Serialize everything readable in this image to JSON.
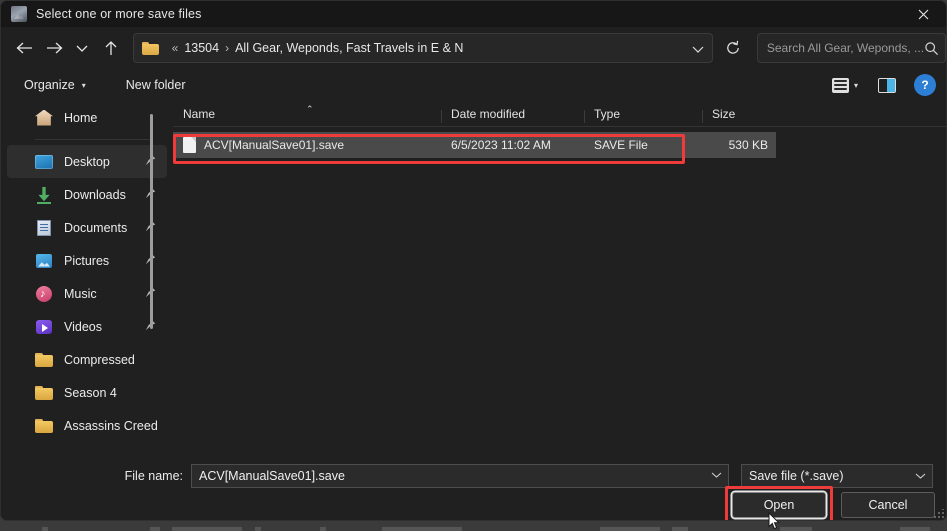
{
  "window": {
    "title": "Select one or more save files",
    "app_icon": "app-image-icon",
    "close_label": "✕"
  },
  "nav": {
    "back_icon": "arrow-left-icon",
    "forward_icon": "arrow-right-icon",
    "recent_icon": "chevron-down-icon",
    "up_icon": "arrow-up-icon",
    "refresh_icon": "refresh-icon",
    "breadcrumb": {
      "folder_icon": "folder-icon",
      "overflow": "«",
      "separator": "›",
      "root": "13504",
      "current": "All Gear, Weponds, Fast Travels in E & N"
    },
    "address_chevron": "chevron-down-icon"
  },
  "search": {
    "placeholder": "Search All Gear, Weponds, ...",
    "value": "",
    "icon": "search-icon"
  },
  "toolbar": {
    "organize_label": "Organize",
    "organize_caret": "▾",
    "new_folder_label": "New folder",
    "view_icon": "list-view-icon",
    "view_caret": "▾",
    "preview_pane_icon": "preview-pane-icon",
    "help_label": "?"
  },
  "sidebar": {
    "home": {
      "label": "Home",
      "icon": "home-icon"
    },
    "pinned": [
      {
        "label": "Desktop",
        "icon": "desktop-icon",
        "pinned": true,
        "selected": true
      },
      {
        "label": "Downloads",
        "icon": "downloads-icon",
        "pinned": true,
        "selected": false
      },
      {
        "label": "Documents",
        "icon": "documents-icon",
        "pinned": true,
        "selected": false
      },
      {
        "label": "Pictures",
        "icon": "pictures-icon",
        "pinned": true,
        "selected": false
      },
      {
        "label": "Music",
        "icon": "music-icon",
        "pinned": true,
        "selected": false
      },
      {
        "label": "Videos",
        "icon": "videos-icon",
        "pinned": true,
        "selected": false
      }
    ],
    "folders": [
      {
        "label": "Compressed",
        "icon": "folder-icon"
      },
      {
        "label": "Season 4",
        "icon": "folder-icon"
      },
      {
        "label": "Assassins Creed",
        "icon": "folder-icon"
      }
    ],
    "pin_glyph": "📌"
  },
  "filelist": {
    "columns": [
      {
        "key": "name",
        "label": "Name",
        "sorted": "asc",
        "sort_glyph": "⌃"
      },
      {
        "key": "date",
        "label": "Date modified"
      },
      {
        "key": "type",
        "label": "Type"
      },
      {
        "key": "size",
        "label": "Size"
      }
    ],
    "rows": [
      {
        "name": "ACV[ManualSave01].save",
        "date": "6/5/2023 11:02 AM",
        "type": "SAVE File",
        "size": "530 KB",
        "icon": "file-icon",
        "selected": true,
        "highlighted": true
      }
    ]
  },
  "footer": {
    "filename_label": "File name:",
    "filename_value": "ACV[ManualSave01].save",
    "filename_caret": "⌄",
    "filter_value": "Save file (*.save)",
    "filter_caret": "⌄",
    "open_label": "Open",
    "cancel_label": "Cancel"
  },
  "colors": {
    "highlight_red": "#f03b3b",
    "accent_blue": "#2c7fd4",
    "selection_gray": "#4a4a4a",
    "window_bg": "#202020",
    "titlebar_bg": "#171717"
  }
}
